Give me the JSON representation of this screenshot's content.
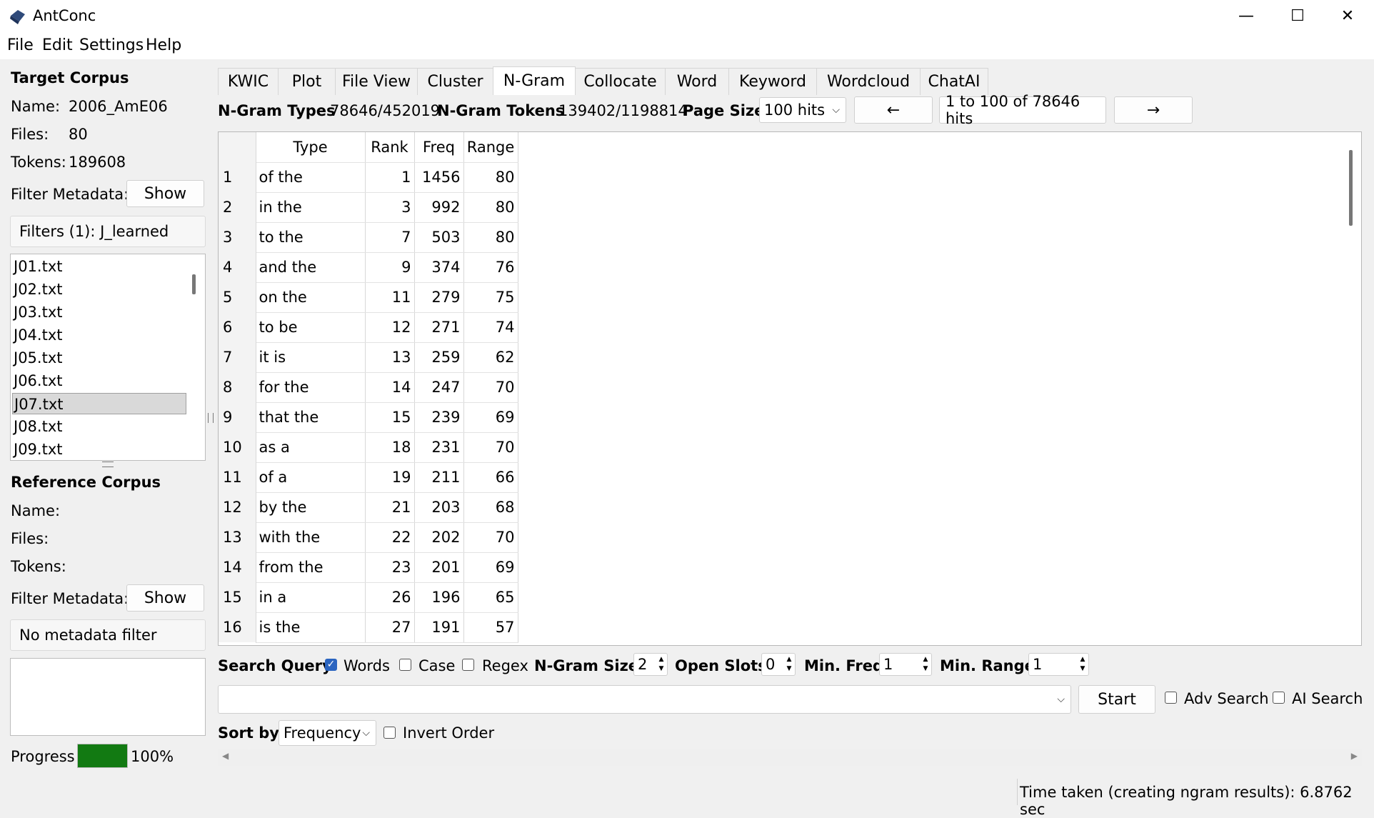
{
  "window": {
    "title": "AntConc",
    "minimize": "—",
    "maximize": "☐",
    "close": "✕"
  },
  "menu": [
    "File",
    "Edit",
    "Settings",
    "Help"
  ],
  "target": {
    "heading": "Target Corpus",
    "name_label": "Name:",
    "name_value": "2006_AmE06",
    "files_label": "Files:",
    "files_value": "80",
    "tokens_label": "Tokens:",
    "tokens_value": "189608",
    "filter_label": "Filter Metadata:",
    "show_button": "Show",
    "filters_text": "Filters (1): J_learned",
    "files": [
      "J01.txt",
      "J02.txt",
      "J03.txt",
      "J04.txt",
      "J05.txt",
      "J06.txt",
      "J07.txt",
      "J08.txt",
      "J09.txt"
    ],
    "selected_file": "J07.txt"
  },
  "reference": {
    "heading": "Reference Corpus",
    "name_label": "Name:",
    "files_label": "Files:",
    "tokens_label": "Tokens:",
    "filter_label": "Filter Metadata:",
    "show_button": "Show",
    "filter_text": "No metadata filter"
  },
  "progress": {
    "label": "Progress",
    "value": "100%",
    "fraction": 1.0,
    "color": "#127a12"
  },
  "tabs": [
    "KWIC",
    "Plot",
    "File View",
    "Cluster",
    "N-Gram",
    "Collocate",
    "Word",
    "Keyword",
    "Wordcloud",
    "ChatAI"
  ],
  "active_tab": "N-Gram",
  "stats": {
    "types_label": "N-Gram Types",
    "types_value": "78646/452019",
    "tokens_label": "N-Gram Tokens",
    "tokens_value": "139402/1198814",
    "page_size_label": "Page Size",
    "page_size_value": "100 hits",
    "prev": "←",
    "range_text": "1 to 100 of 78646 hits",
    "next": "→"
  },
  "table": {
    "headers": [
      "Type",
      "Rank",
      "Freq",
      "Range"
    ],
    "rows": [
      [
        "1",
        "of the",
        "1",
        "1456",
        "80"
      ],
      [
        "2",
        "in the",
        "3",
        "992",
        "80"
      ],
      [
        "3",
        "to the",
        "7",
        "503",
        "80"
      ],
      [
        "4",
        "and the",
        "9",
        "374",
        "76"
      ],
      [
        "5",
        "on the",
        "11",
        "279",
        "75"
      ],
      [
        "6",
        "to be",
        "12",
        "271",
        "74"
      ],
      [
        "7",
        "it is",
        "13",
        "259",
        "62"
      ],
      [
        "8",
        "for the",
        "14",
        "247",
        "70"
      ],
      [
        "9",
        "that the",
        "15",
        "239",
        "69"
      ],
      [
        "10",
        "as a",
        "18",
        "231",
        "70"
      ],
      [
        "11",
        "of a",
        "19",
        "211",
        "66"
      ],
      [
        "12",
        "by the",
        "21",
        "203",
        "68"
      ],
      [
        "13",
        "with the",
        "22",
        "202",
        "70"
      ],
      [
        "14",
        "from the",
        "23",
        "201",
        "69"
      ],
      [
        "15",
        "in a",
        "26",
        "196",
        "65"
      ],
      [
        "16",
        "is the",
        "27",
        "191",
        "57"
      ]
    ]
  },
  "search": {
    "query_label": "Search Query",
    "words_label": "Words",
    "words_checked": true,
    "case_label": "Case",
    "case_checked": false,
    "regex_label": "Regex",
    "regex_checked": false,
    "ngram_size_label": "N-Gram Size",
    "ngram_size_value": "2",
    "open_slots_label": "Open Slots",
    "open_slots_value": "0",
    "min_freq_label": "Min. Freq",
    "min_freq_value": "1",
    "min_range_label": "Min. Range",
    "min_range_value": "1",
    "query_value": "",
    "start_button": "Start",
    "adv_search_label": "Adv Search",
    "ai_search_label": "AI Search",
    "sort_label": "Sort by",
    "sort_value": "Frequency",
    "invert_label": "Invert Order"
  },
  "status": {
    "text": "Time taken (creating ngram results):  6.8762 sec"
  }
}
